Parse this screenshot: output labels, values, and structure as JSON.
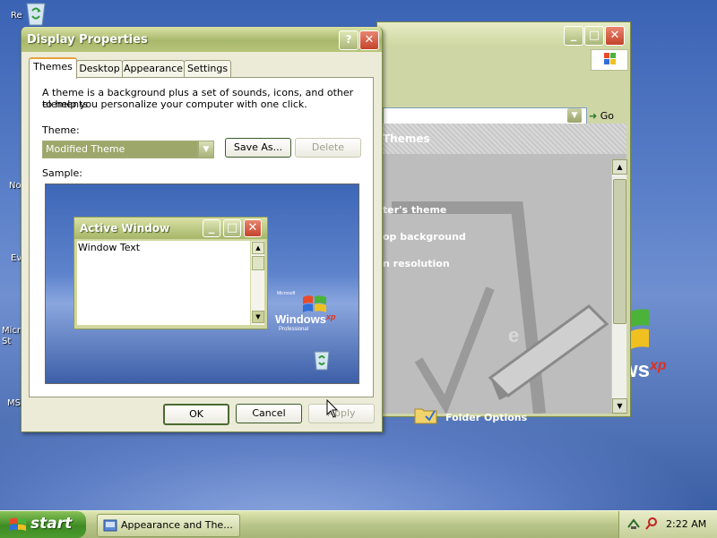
{
  "desktop": {
    "icons": [
      {
        "name": "Recycle Bin",
        "label": "Re"
      },
      {
        "name": "Notepad",
        "label": "No"
      },
      {
        "name": "Eve",
        "label": "Ev"
      },
      {
        "name": "Microsoft Setup",
        "label": "Micr\nSt"
      },
      {
        "name": "MSN",
        "label": "MS"
      }
    ],
    "brand": "Windows",
    "brand_xp": "xp"
  },
  "explorer_window": {
    "go_label": "Go",
    "panel_title": "Themes",
    "tasks": [
      "ter's theme",
      "op background",
      "n resolution"
    ],
    "folder_options": "Folder Options"
  },
  "dialog": {
    "title": "Display Properties",
    "help_btn": "?",
    "close_btn": "✕",
    "tabs": [
      "Themes",
      "Desktop",
      "Appearance",
      "Settings"
    ],
    "description_line1": "A theme is a background plus a set of sounds, icons, and other elements",
    "description_line2": "to help you personalize your computer with one click.",
    "theme_label": "Theme:",
    "theme_value": "Modified Theme",
    "save_as_label": "Save As...",
    "delete_label": "Delete",
    "sample_label": "Sample:",
    "active_window_title": "Active Window",
    "window_text": "Window Text",
    "sample_logo_small": "Microsoft",
    "sample_logo": "Windows",
    "sample_logo_xp": "xp",
    "sample_logo_edition": "Professional",
    "ok_label": "OK",
    "cancel_label": "Cancel",
    "apply_label": "Apply"
  },
  "taskbar": {
    "start_label": "start",
    "task_item": "Appearance and The...",
    "clock": "2:22 AM"
  },
  "colors": {
    "title_olive": "#a8b86b",
    "desktop_blue": "#3b63b4",
    "start_green": "#3d8b24"
  }
}
